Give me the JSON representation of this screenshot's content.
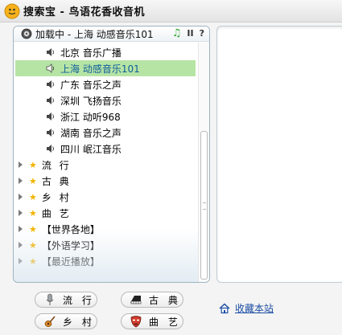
{
  "window": {
    "title": "搜索宝 - 鸟语花香收音机"
  },
  "now_playing": {
    "text": "加载中 - 上海 动感音乐101",
    "controls": {
      "note": "♫",
      "pause": "II",
      "help": "?"
    }
  },
  "stations": [
    {
      "label": "北京 音乐广播",
      "selected": false
    },
    {
      "label": "上海 动感音乐101",
      "selected": true
    },
    {
      "label": "广东 音乐之声",
      "selected": false
    },
    {
      "label": "深圳 飞扬音乐",
      "selected": false
    },
    {
      "label": "浙江 动听968",
      "selected": false
    },
    {
      "label": "湖南 音乐之声",
      "selected": false
    },
    {
      "label": "四川 岷江音乐",
      "selected": false
    }
  ],
  "categories": [
    {
      "label": "流 行"
    },
    {
      "label": "古 典"
    },
    {
      "label": "乡 村"
    },
    {
      "label": "曲 艺"
    },
    {
      "label": "【世界各地】"
    },
    {
      "label": "【外语学习】"
    },
    {
      "label": "【最近播放】"
    }
  ],
  "bottom_buttons": [
    {
      "label": "流 行",
      "icon": "microphone-icon"
    },
    {
      "label": "古 典",
      "icon": "piano-icon"
    },
    {
      "label": "乡 村",
      "icon": "guitar-icon"
    },
    {
      "label": "曲 艺",
      "icon": "opera-mask-icon"
    }
  ],
  "favorite_link": {
    "label": "收藏本站",
    "icon": "home-icon"
  },
  "colors": {
    "selected_row_bg": "#b6e4a4",
    "selected_row_text": "#0f5e9e",
    "star": "#f2b400",
    "link": "#1a4ca3"
  }
}
